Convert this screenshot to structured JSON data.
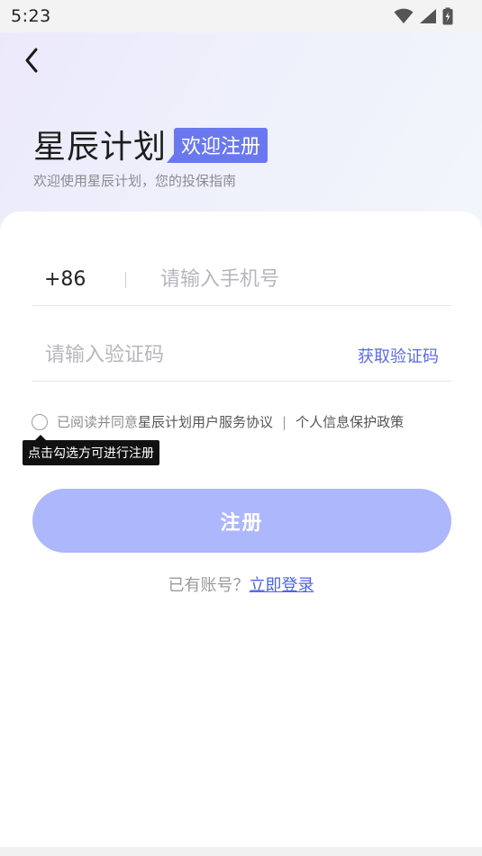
{
  "status_bar": {
    "time": "5:23",
    "icons": [
      "wifi-icon",
      "signal-icon",
      "battery-charging-icon"
    ]
  },
  "header": {
    "back_icon": "chevron-left-icon",
    "app_title": "星辰计划",
    "welcome_tag": "欢迎注册",
    "subtitle": "欢迎使用星辰计划，您的投保指南"
  },
  "form": {
    "country_code": "+86",
    "phone_placeholder": "请输入手机号",
    "code_placeholder": "请输入验证码",
    "get_code_label": "获取验证码"
  },
  "agreement": {
    "prefix": "已阅读并同意",
    "user_agreement": "星辰计划用户服务协议",
    "separator": "|",
    "privacy_policy": "个人信息保护政策",
    "tooltip": "点击勾选方可进行注册"
  },
  "register_label": "注册",
  "login": {
    "prompt": "已有账号？",
    "link": "立即登录"
  },
  "colors": {
    "accent": "#5b6be8",
    "register_button": "#adb7fb",
    "welcome_tag": "#6a78f0"
  }
}
